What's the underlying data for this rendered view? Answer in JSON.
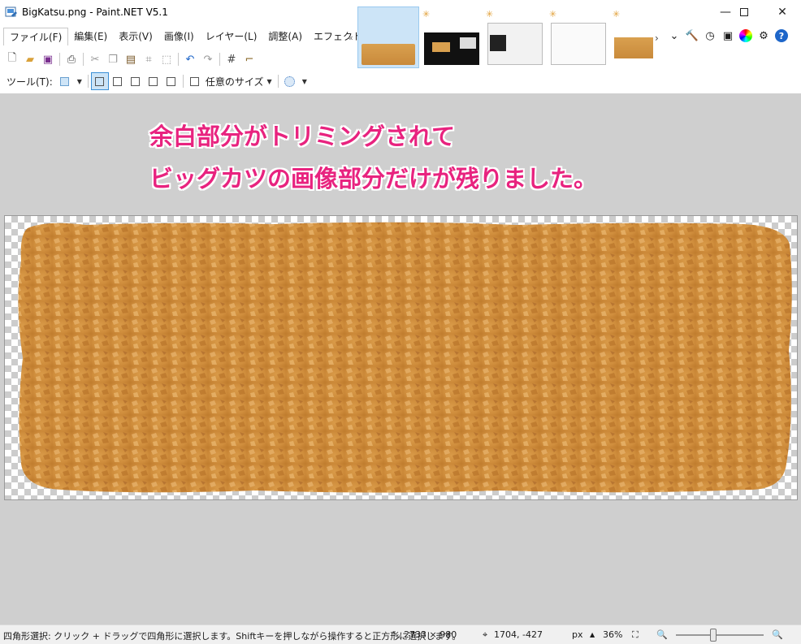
{
  "window": {
    "title": "BigKatsu.png - Paint.NET V5.1",
    "minimize_icon": "minimize-icon",
    "maximize_icon": "maximize-icon",
    "close_icon": "close-icon"
  },
  "menu": {
    "items": [
      "ファイル(F)",
      "編集(E)",
      "表示(V)",
      "画像(I)",
      "レイヤー(L)",
      "調整(A)",
      "エフェクト(C)"
    ],
    "scroll_left": "«"
  },
  "thumbnails": {
    "next": "›",
    "more": "⌄"
  },
  "tool_options": {
    "tool_label": "ツール(T):",
    "size_label": "任意のサイズ"
  },
  "annotation": {
    "line1": "余白部分がトリミングされて",
    "line2": "ビッグカツの画像部分だけが残りました。"
  },
  "status": {
    "hint": "四角形選択: クリック + ドラッグで四角形に選択します。Shiftキーを押しながら操作すると正方形に選択します。",
    "image_size": "2733 × 980",
    "cursor_pos": "1704, -427",
    "unit": "px",
    "zoom": "36%"
  },
  "colors": {
    "accent_pink": "#e8237f",
    "canvas_bg": "#cfcfcf",
    "selection_blue": "#cce4f7"
  }
}
